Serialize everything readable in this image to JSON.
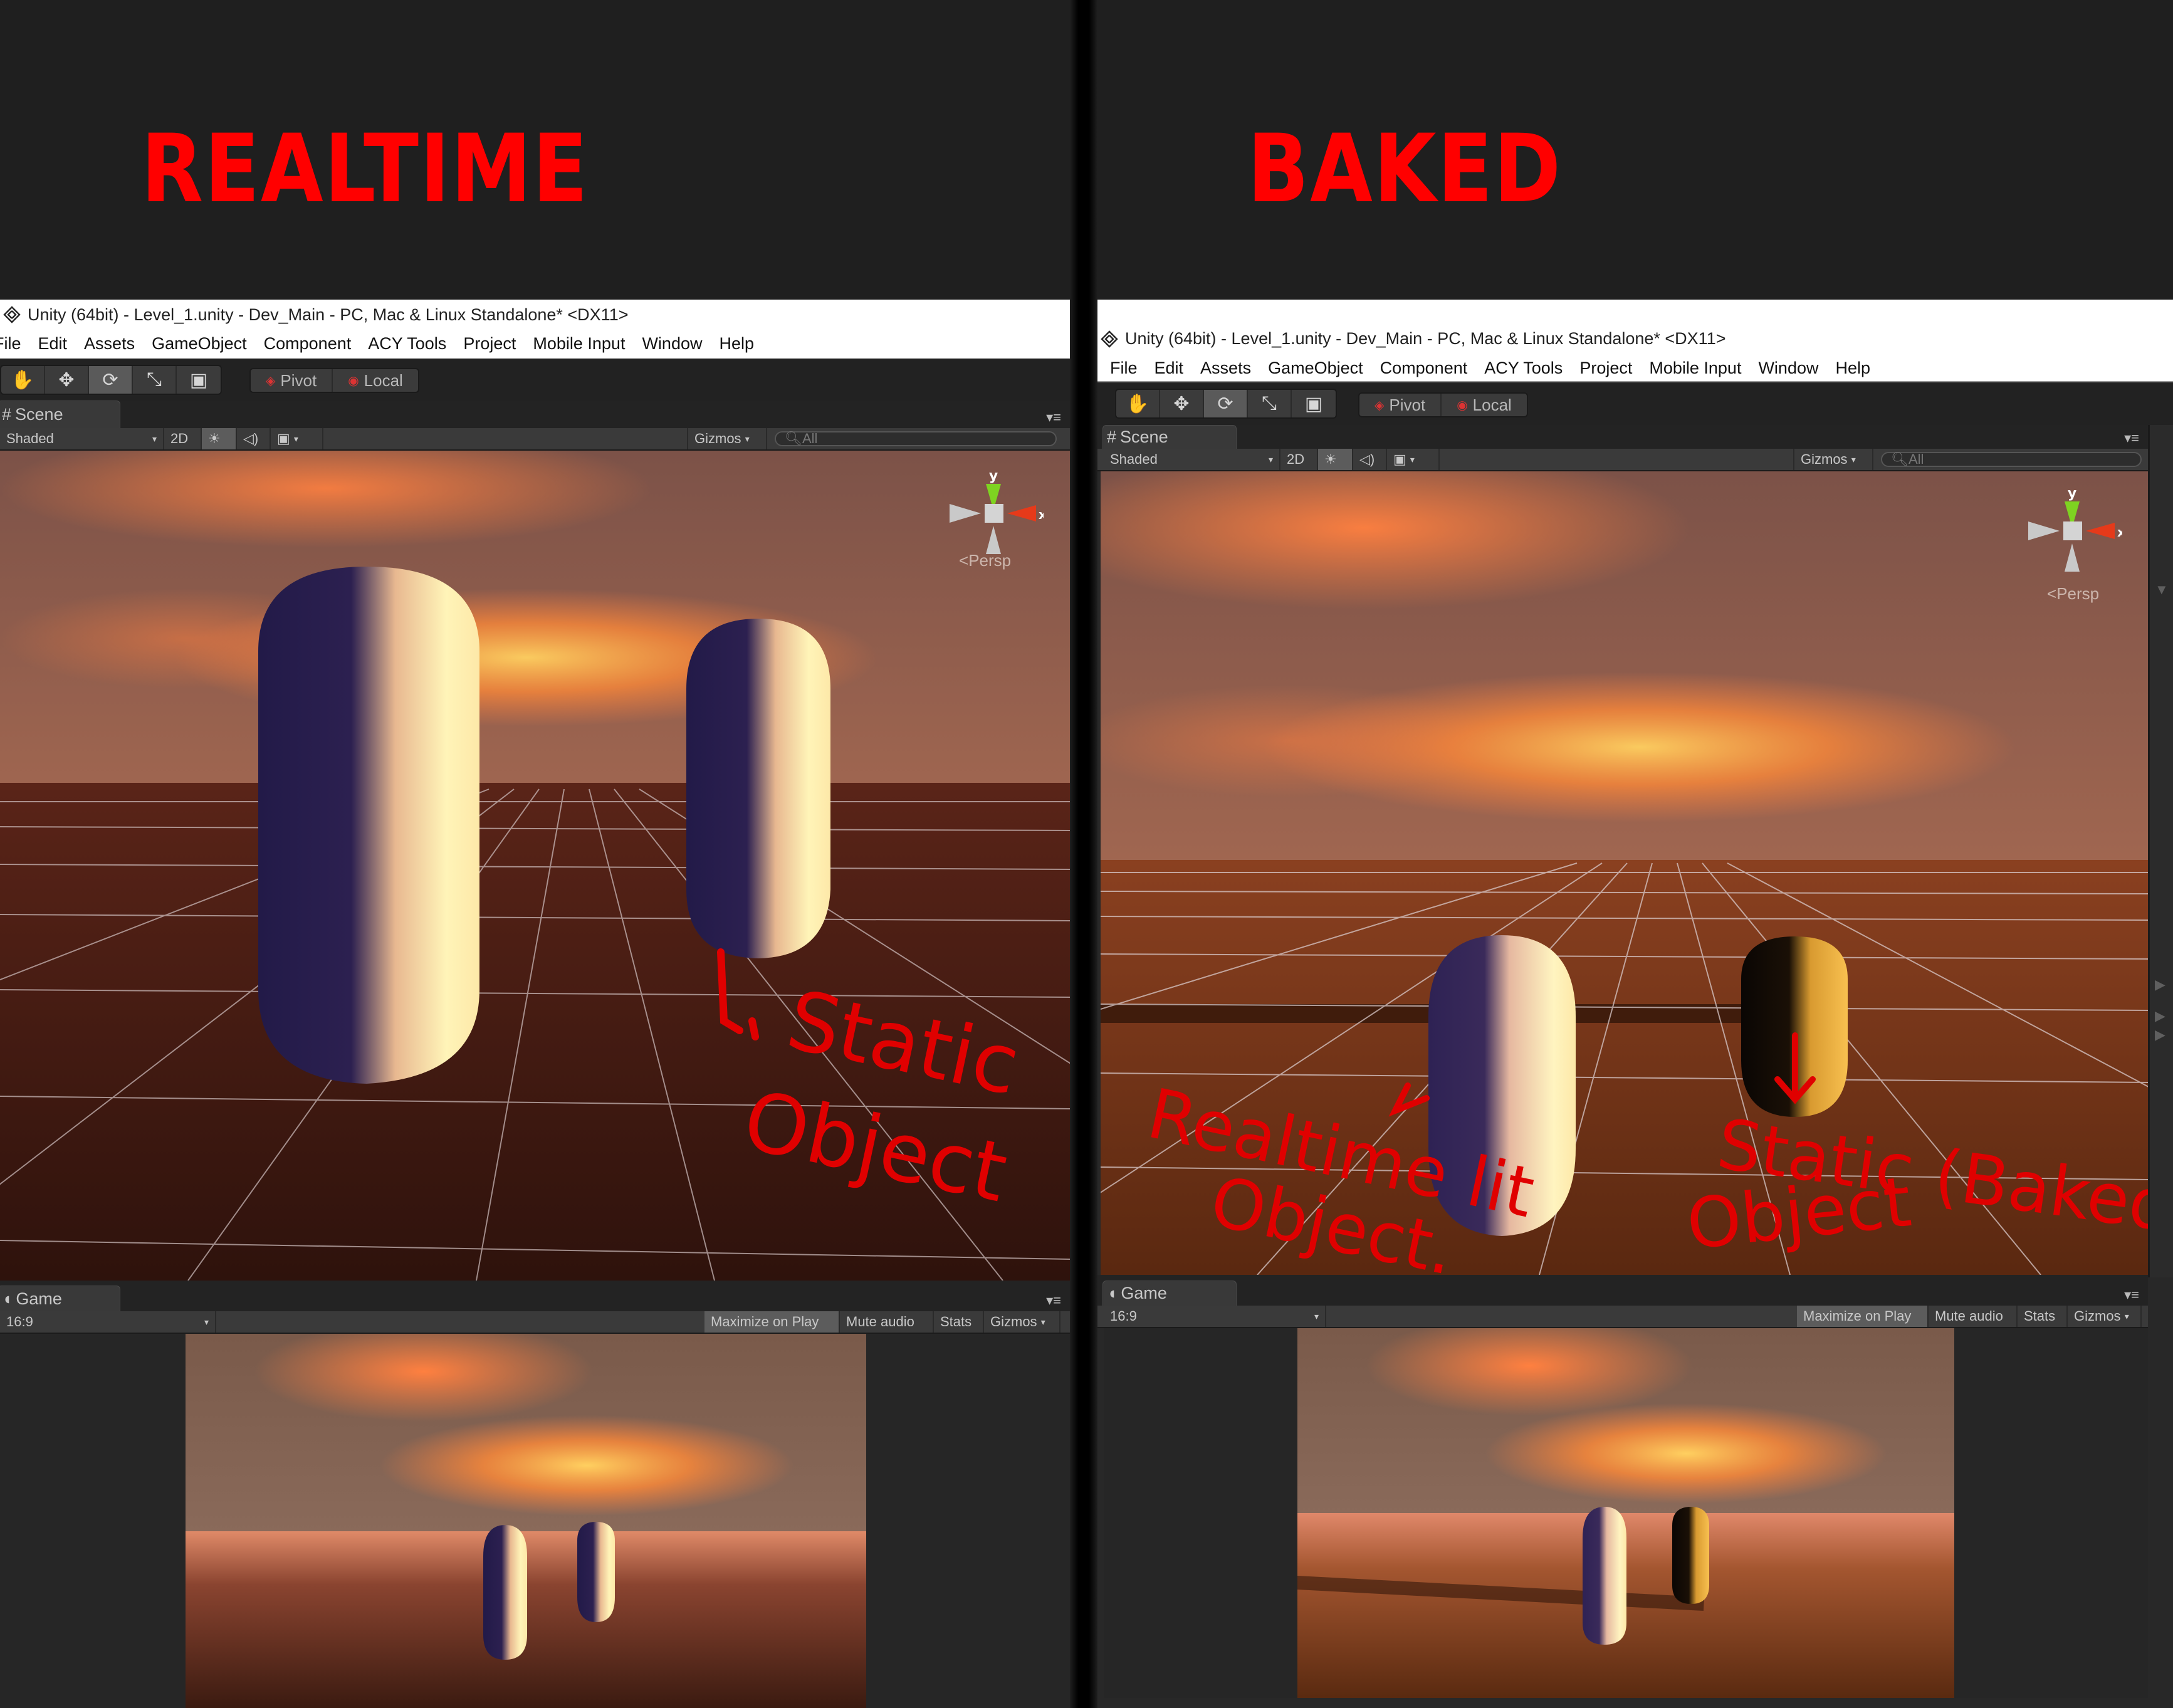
{
  "headings": {
    "left": "REALTIME",
    "right": "BAKED",
    "color": "#ff0000"
  },
  "window": {
    "title": "Unity (64bit) - Level_1.unity - Dev_Main - PC, Mac & Linux Standalone* <DX11>",
    "menu": [
      "File",
      "Edit",
      "Assets",
      "GameObject",
      "Component",
      "ACY Tools",
      "Project",
      "Mobile Input",
      "Window",
      "Help"
    ],
    "tools": [
      {
        "name": "hand-tool",
        "glyph": "✋"
      },
      {
        "name": "move-tool",
        "glyph": "✥"
      },
      {
        "name": "rotate-tool",
        "glyph": "⟳"
      },
      {
        "name": "scale-tool",
        "glyph": "⤡"
      },
      {
        "name": "rect-tool",
        "glyph": "▣"
      }
    ],
    "pivot_label": "Pivot",
    "local_label": "Local"
  },
  "scene_panel": {
    "tab_label": "Scene",
    "draw_mode": "Shaded",
    "mode_2d": "2D",
    "gizmos_label": "Gizmos",
    "search_placeholder": "All",
    "persp_label": "Persp",
    "axis_y": "y",
    "axis_x": "x"
  },
  "game_panel": {
    "tab_label": "Game",
    "aspect": "16:9",
    "maximize_on_play": "Maximize on Play",
    "mute_audio": "Mute audio",
    "stats": "Stats",
    "gizmos_label": "Gizmos"
  },
  "annotations": {
    "left_static": [
      "Static",
      "Object"
    ],
    "right_realtime": [
      "Realtime lit",
      "Object."
    ],
    "right_static": [
      "Static (Baked)",
      "Object"
    ],
    "color": "#e00000"
  },
  "scene_colors": {
    "sky_top": "#7a5048",
    "cloud": "#f07830",
    "cloud_glow": "#ffc050",
    "ground_realtime": "#3a1a12",
    "ground_baked": "#6a2e12",
    "capsule_shadow": "#2a1e52",
    "capsule_lit": "#fff3b8",
    "baked_dark": "#0d0805",
    "baked_lit": "#f3b640"
  }
}
